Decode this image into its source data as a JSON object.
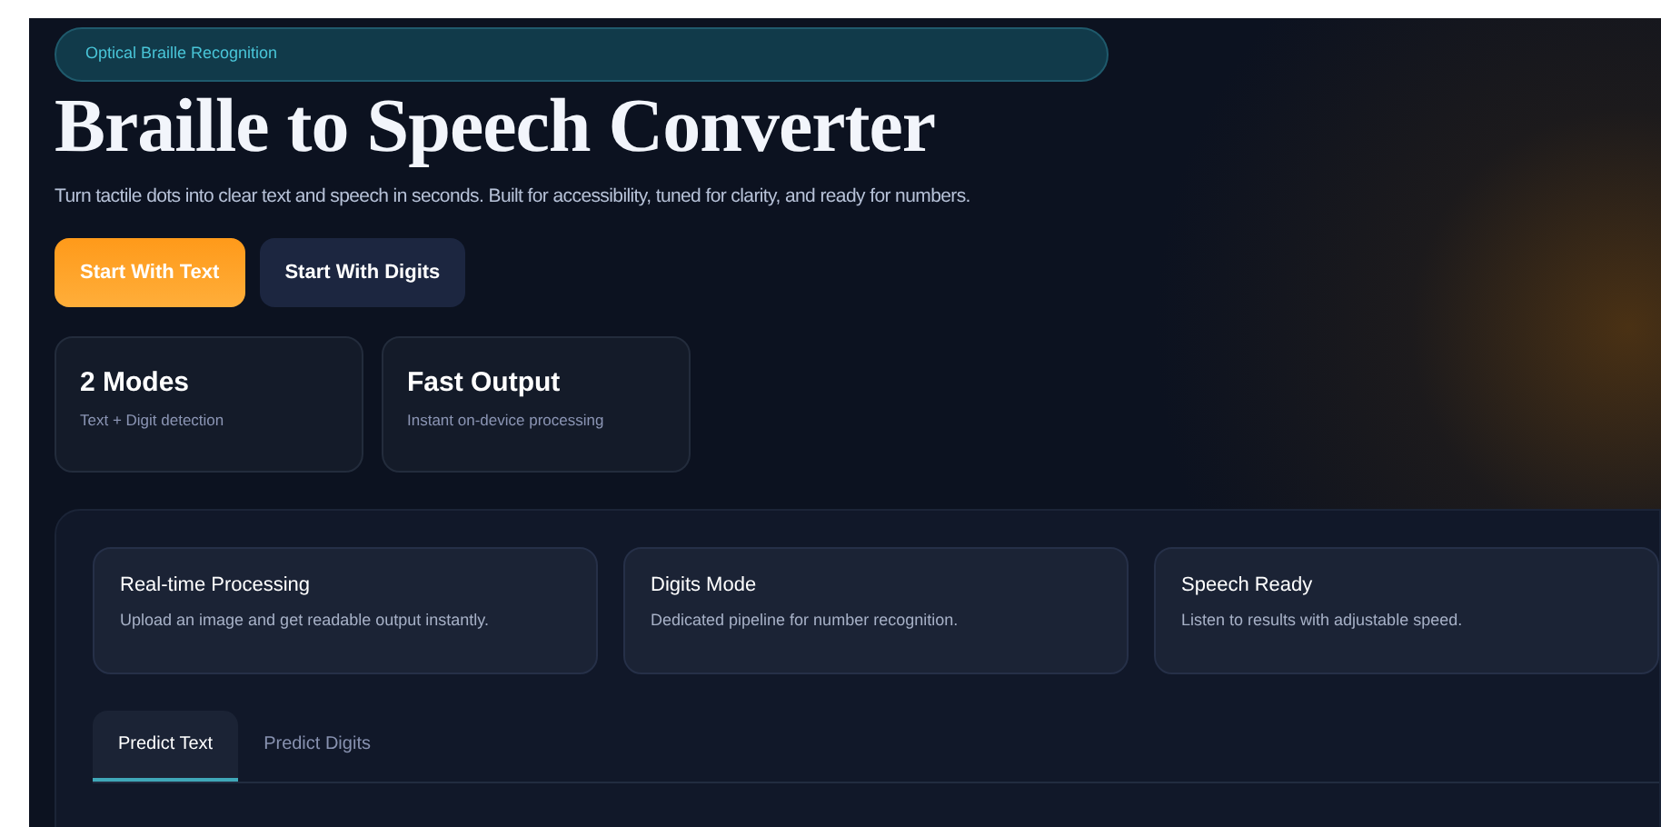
{
  "badge": "Optical Braille Recognition",
  "title": "Braille to Speech Converter",
  "subtitle": "Turn tactile dots into clear text and speech in seconds. Built for accessibility, tuned for clarity, and ready for numbers.",
  "buttons": [
    {
      "label": "Start With Text",
      "kind": "primary"
    },
    {
      "label": "Start With Digits",
      "kind": "secondary"
    }
  ],
  "stats": [
    {
      "value": "2 Modes",
      "caption": "Text + Digit detection"
    },
    {
      "value": "Fast Output",
      "caption": "Instant on-device processing"
    }
  ],
  "features": [
    {
      "title": "Real-time Processing",
      "text": "Upload an image and get readable output instantly."
    },
    {
      "title": "Digits Mode",
      "text": "Dedicated pipeline for number recognition."
    },
    {
      "title": "Speech Ready",
      "text": "Listen to results with adjustable speed."
    }
  ],
  "tabs": [
    {
      "label": "Predict Text",
      "selected": true
    },
    {
      "label": "Predict Digits",
      "selected": false
    }
  ]
}
